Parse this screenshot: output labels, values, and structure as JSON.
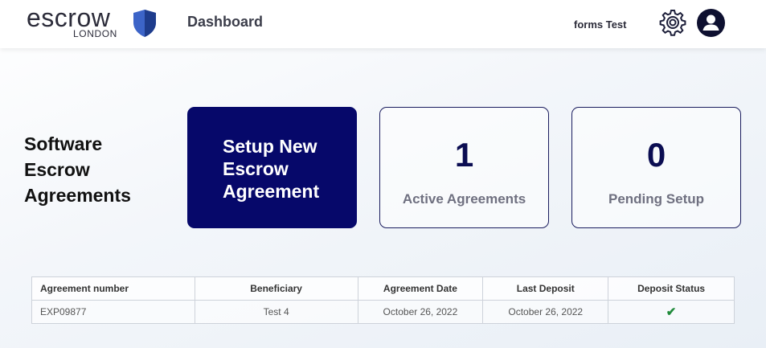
{
  "header": {
    "logo_word": "escrow",
    "logo_sub": "LONDON",
    "page_title": "Dashboard",
    "user_name": "forms Test"
  },
  "section": {
    "title": "Software Escrow Agreements"
  },
  "cards": {
    "setup": {
      "label": "Setup New Escrow Agreement"
    },
    "active": {
      "count": "1",
      "label": "Active Agreements"
    },
    "pending": {
      "count": "0",
      "label": "Pending Setup"
    }
  },
  "table": {
    "headers": [
      "Agreement number",
      "Beneficiary",
      "Agreement Date",
      "Last Deposit",
      "Deposit Status"
    ],
    "rows": [
      {
        "agreement_number": "EXP09877",
        "beneficiary": "Test 4",
        "agreement_date": "October 26, 2022",
        "last_deposit": "October 26, 2022",
        "deposit_status": "✔"
      }
    ]
  },
  "colors": {
    "primary": "#06086a",
    "stat_number": "#0b0d52",
    "success": "#1f8a3a",
    "shield_fill": "#3c64c8"
  },
  "icons": {
    "logo": "shield-icon",
    "settings": "gear-icon",
    "profile": "user-avatar-icon",
    "status": "check-icon"
  }
}
